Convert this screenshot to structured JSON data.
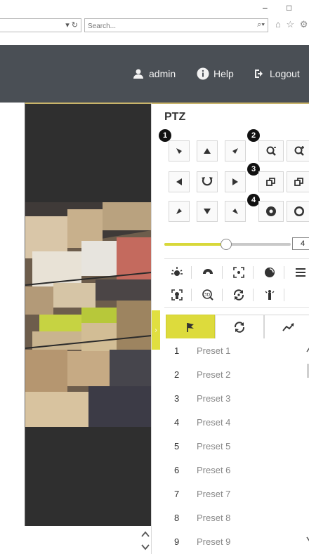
{
  "browser": {
    "search_placeholder": "Search...",
    "url_controls": "▾ ↻",
    "search_controls": "⌕▾",
    "window_minimize": "–",
    "window_maximize": "□",
    "toolbar_icons": "⌂ ☆ ⚙"
  },
  "header": {
    "user_label": "admin",
    "help_label": "Help",
    "logout_label": "Logout"
  },
  "ptz": {
    "title": "PTZ",
    "speed_value": "4",
    "speed_level_fraction": 0.49,
    "badges": [
      "1",
      "2",
      "3",
      "4"
    ],
    "tab_icons": [
      "flag-icon",
      "patrol-icon",
      "pattern-icon"
    ],
    "presets": [
      {
        "num": "1",
        "name": "Preset 1"
      },
      {
        "num": "2",
        "name": "Preset 2"
      },
      {
        "num": "3",
        "name": "Preset 3"
      },
      {
        "num": "4",
        "name": "Preset 4"
      },
      {
        "num": "5",
        "name": "Preset 5"
      },
      {
        "num": "6",
        "name": "Preset 6"
      },
      {
        "num": "7",
        "name": "Preset 7"
      },
      {
        "num": "8",
        "name": "Preset 8"
      },
      {
        "num": "9",
        "name": "Preset 9"
      }
    ]
  },
  "colors": {
    "header_bg": "#4a4f55",
    "accent_yellow": "#dddb3c",
    "video_bg": "#2f2f2f"
  }
}
